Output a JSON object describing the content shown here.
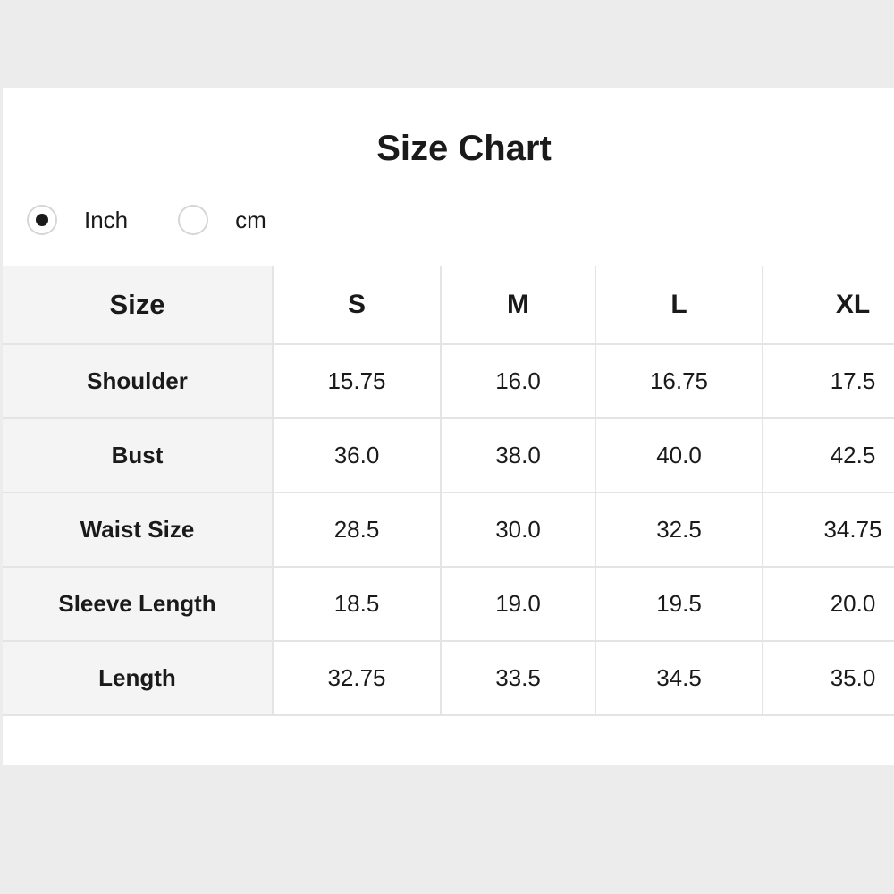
{
  "title": "Size Chart",
  "unit_toggle": {
    "options": [
      {
        "label": "Inch",
        "selected": true
      },
      {
        "label": "cm",
        "selected": false
      }
    ]
  },
  "table": {
    "corner_label": "Size",
    "columns": [
      "S",
      "M",
      "L",
      "XL"
    ],
    "rows": [
      {
        "label": "Shoulder",
        "values": [
          "15.75",
          "16.0",
          "16.75",
          "17.5"
        ]
      },
      {
        "label": "Bust",
        "values": [
          "36.0",
          "38.0",
          "40.0",
          "42.5"
        ]
      },
      {
        "label": "Waist Size",
        "values": [
          "28.5",
          "30.0",
          "32.5",
          "34.75"
        ]
      },
      {
        "label": "Sleeve Length",
        "values": [
          "18.5",
          "19.0",
          "19.5",
          "20.0"
        ]
      },
      {
        "label": "Length",
        "values": [
          "32.75",
          "33.5",
          "34.5",
          "35.0"
        ]
      }
    ]
  },
  "colors": {
    "page_background": "#ececec",
    "panel_background": "#ffffff",
    "header_cell_background": "#f4f4f4",
    "grid_line": "#e4e4e4",
    "text": "#1a1a1a"
  }
}
